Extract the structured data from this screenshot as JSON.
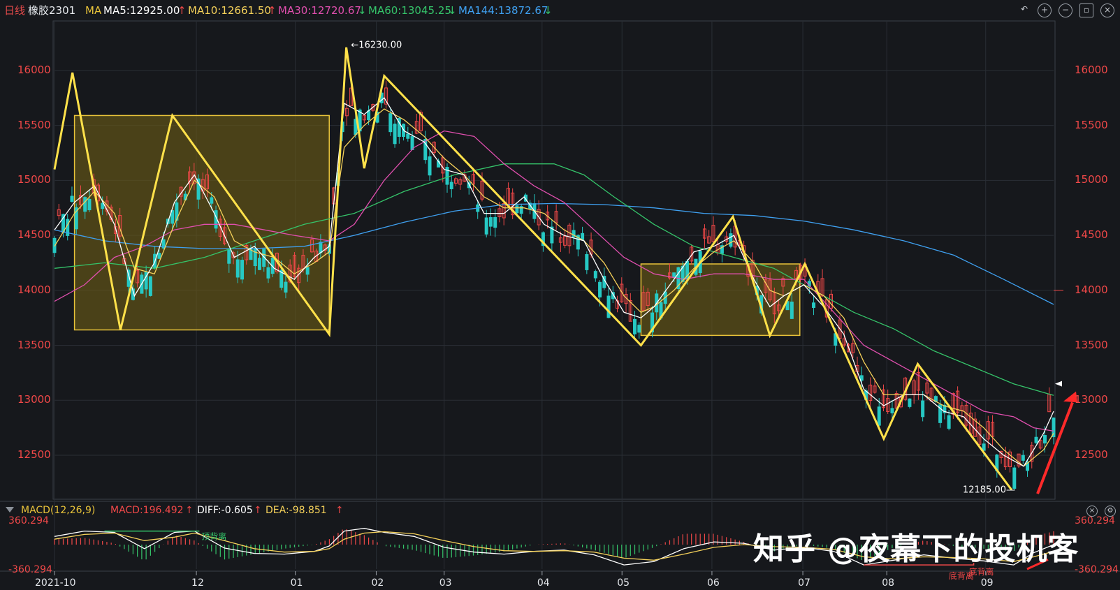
{
  "header": {
    "period": "日线",
    "symbol": "橡胶2301",
    "ma_prefix": "MA",
    "ma5": "MA5:12925.00",
    "ma10": "MA10:12661.50",
    "ma30": "MA30:12720.67",
    "ma60": "MA60:13045.25",
    "ma144": "MA144:13872.67",
    "arrow_up": "↑",
    "arrow_down": "↓",
    "icons": [
      "undo-icon",
      "zoom-in-icon",
      "zoom-out-icon",
      "layout-icon",
      "close-icon"
    ]
  },
  "macd_header": {
    "name": "MACD(12,26,9)",
    "macd": "MACD:196.492",
    "diff": "DIFF:-0.605",
    "dea": "DEA:-98.851",
    "arrow_up": "↑"
  },
  "colors": {
    "up": "#f04848",
    "down": "#26c9c4",
    "ma5": "#ffffff",
    "ma10": "#f5d15a",
    "ma30": "#e04fae",
    "ma60": "#35c46a",
    "ma144": "#3fa0f0",
    "zigzag": "#ffe14a",
    "box_fill": "#6b5a16",
    "box_stroke": "#e8c33a",
    "grid": "#2a2e35"
  },
  "watermark": "知乎 @夜幕下的投机客",
  "chart_data": {
    "type": "candlestick",
    "ylim": [
      12100,
      16450
    ],
    "y_ticks": [
      12500,
      13000,
      13500,
      14000,
      14500,
      15000,
      15500,
      16000
    ],
    "x_ticks": [
      "2021-10",
      "12",
      "01",
      "02",
      "03",
      "04",
      "05",
      "06",
      "07",
      "08",
      "09"
    ],
    "annotations": {
      "high": "16230.00",
      "low": "12185.00",
      "current_marker": 14000,
      "macd_max": "360.294",
      "macd_min": "-360.294",
      "divergence_1": "顶背离",
      "divergence_2": "底背离",
      "divergence_3": "底背离"
    },
    "boxes": [
      {
        "x0": 0.02,
        "x1": 0.275,
        "y0": 13640,
        "y1": 15590
      },
      {
        "x0": 0.587,
        "x1": 0.746,
        "y0": 13590,
        "y1": 14240
      }
    ],
    "zigzag": [
      [
        0.0,
        15100
      ],
      [
        0.018,
        15980
      ],
      [
        0.066,
        13640
      ],
      [
        0.118,
        15590
      ],
      [
        0.275,
        13600
      ],
      [
        0.292,
        16210
      ],
      [
        0.31,
        15110
      ],
      [
        0.33,
        15950
      ],
      [
        0.587,
        13500
      ],
      [
        0.679,
        14670
      ],
      [
        0.716,
        13590
      ],
      [
        0.751,
        14240
      ],
      [
        0.83,
        12650
      ],
      [
        0.864,
        13330
      ],
      [
        0.958,
        12185
      ]
    ],
    "ma5": [
      [
        0,
        14550
      ],
      [
        0.02,
        14800
      ],
      [
        0.04,
        14950
      ],
      [
        0.06,
        14600
      ],
      [
        0.08,
        13950
      ],
      [
        0.1,
        14250
      ],
      [
        0.12,
        14800
      ],
      [
        0.14,
        15050
      ],
      [
        0.16,
        14700
      ],
      [
        0.18,
        14300
      ],
      [
        0.2,
        14400
      ],
      [
        0.22,
        14200
      ],
      [
        0.24,
        14100
      ],
      [
        0.26,
        14300
      ],
      [
        0.275,
        14400
      ],
      [
        0.29,
        15700
      ],
      [
        0.31,
        15600
      ],
      [
        0.33,
        15750
      ],
      [
        0.35,
        15450
      ],
      [
        0.37,
        15350
      ],
      [
        0.39,
        15100
      ],
      [
        0.41,
        15050
      ],
      [
        0.43,
        14700
      ],
      [
        0.45,
        14700
      ],
      [
        0.47,
        14850
      ],
      [
        0.49,
        14600
      ],
      [
        0.51,
        14500
      ],
      [
        0.53,
        14450
      ],
      [
        0.55,
        14100
      ],
      [
        0.57,
        13800
      ],
      [
        0.587,
        13750
      ],
      [
        0.6,
        13850
      ],
      [
        0.62,
        14100
      ],
      [
        0.64,
        14350
      ],
      [
        0.66,
        14400
      ],
      [
        0.68,
        14500
      ],
      [
        0.7,
        14100
      ],
      [
        0.716,
        13850
      ],
      [
        0.73,
        13950
      ],
      [
        0.75,
        14050
      ],
      [
        0.77,
        13850
      ],
      [
        0.79,
        13600
      ],
      [
        0.81,
        13100
      ],
      [
        0.83,
        12950
      ],
      [
        0.85,
        13050
      ],
      [
        0.87,
        13050
      ],
      [
        0.89,
        12900
      ],
      [
        0.91,
        12850
      ],
      [
        0.93,
        12650
      ],
      [
        0.95,
        12500
      ],
      [
        0.97,
        12400
      ],
      [
        0.99,
        12700
      ],
      [
        1.0,
        12900
      ]
    ],
    "ma10": [
      [
        0,
        14400
      ],
      [
        0.02,
        14700
      ],
      [
        0.04,
        14900
      ],
      [
        0.06,
        14700
      ],
      [
        0.08,
        14200
      ],
      [
        0.1,
        14150
      ],
      [
        0.12,
        14600
      ],
      [
        0.14,
        15000
      ],
      [
        0.16,
        14850
      ],
      [
        0.18,
        14450
      ],
      [
        0.2,
        14350
      ],
      [
        0.22,
        14300
      ],
      [
        0.24,
        14150
      ],
      [
        0.26,
        14250
      ],
      [
        0.275,
        14350
      ],
      [
        0.29,
        15300
      ],
      [
        0.31,
        15500
      ],
      [
        0.33,
        15650
      ],
      [
        0.35,
        15550
      ],
      [
        0.37,
        15400
      ],
      [
        0.39,
        15200
      ],
      [
        0.41,
        15050
      ],
      [
        0.43,
        14850
      ],
      [
        0.45,
        14750
      ],
      [
        0.47,
        14750
      ],
      [
        0.49,
        14700
      ],
      [
        0.51,
        14550
      ],
      [
        0.53,
        14450
      ],
      [
        0.55,
        14250
      ],
      [
        0.57,
        13950
      ],
      [
        0.587,
        13800
      ],
      [
        0.6,
        13850
      ],
      [
        0.62,
        14000
      ],
      [
        0.64,
        14200
      ],
      [
        0.66,
        14350
      ],
      [
        0.68,
        14450
      ],
      [
        0.7,
        14250
      ],
      [
        0.716,
        14000
      ],
      [
        0.73,
        13950
      ],
      [
        0.75,
        14050
      ],
      [
        0.77,
        13950
      ],
      [
        0.79,
        13750
      ],
      [
        0.81,
        13350
      ],
      [
        0.83,
        13050
      ],
      [
        0.85,
        13050
      ],
      [
        0.87,
        13050
      ],
      [
        0.89,
        12950
      ],
      [
        0.91,
        12900
      ],
      [
        0.93,
        12750
      ],
      [
        0.95,
        12550
      ],
      [
        0.97,
        12400
      ],
      [
        0.99,
        12550
      ],
      [
        1.0,
        12700
      ]
    ],
    "ma30": [
      [
        0,
        13900
      ],
      [
        0.03,
        14050
      ],
      [
        0.06,
        14300
      ],
      [
        0.09,
        14400
      ],
      [
        0.12,
        14550
      ],
      [
        0.15,
        14600
      ],
      [
        0.18,
        14600
      ],
      [
        0.21,
        14550
      ],
      [
        0.24,
        14500
      ],
      [
        0.275,
        14450
      ],
      [
        0.3,
        14600
      ],
      [
        0.33,
        15000
      ],
      [
        0.36,
        15300
      ],
      [
        0.39,
        15450
      ],
      [
        0.42,
        15400
      ],
      [
        0.45,
        15150
      ],
      [
        0.48,
        14950
      ],
      [
        0.51,
        14800
      ],
      [
        0.54,
        14550
      ],
      [
        0.57,
        14300
      ],
      [
        0.6,
        14150
      ],
      [
        0.63,
        14100
      ],
      [
        0.66,
        14150
      ],
      [
        0.69,
        14150
      ],
      [
        0.72,
        14100
      ],
      [
        0.75,
        14100
      ],
      [
        0.78,
        13800
      ],
      [
        0.81,
        13500
      ],
      [
        0.84,
        13350
      ],
      [
        0.87,
        13200
      ],
      [
        0.9,
        13050
      ],
      [
        0.93,
        12900
      ],
      [
        0.96,
        12850
      ],
      [
        0.98,
        12750
      ],
      [
        1.0,
        12720
      ]
    ],
    "ma60": [
      [
        0,
        14200
      ],
      [
        0.05,
        14250
      ],
      [
        0.1,
        14200
      ],
      [
        0.15,
        14300
      ],
      [
        0.2,
        14450
      ],
      [
        0.25,
        14600
      ],
      [
        0.3,
        14700
      ],
      [
        0.35,
        14900
      ],
      [
        0.4,
        15050
      ],
      [
        0.45,
        15150
      ],
      [
        0.5,
        15150
      ],
      [
        0.53,
        15050
      ],
      [
        0.56,
        14850
      ],
      [
        0.6,
        14600
      ],
      [
        0.64,
        14400
      ],
      [
        0.68,
        14300
      ],
      [
        0.72,
        14200
      ],
      [
        0.76,
        14000
      ],
      [
        0.8,
        13800
      ],
      [
        0.84,
        13650
      ],
      [
        0.88,
        13450
      ],
      [
        0.92,
        13300
      ],
      [
        0.96,
        13150
      ],
      [
        1.0,
        13045
      ]
    ],
    "ma144": [
      [
        0,
        14550
      ],
      [
        0.05,
        14450
      ],
      [
        0.1,
        14400
      ],
      [
        0.15,
        14380
      ],
      [
        0.2,
        14380
      ],
      [
        0.25,
        14400
      ],
      [
        0.3,
        14500
      ],
      [
        0.35,
        14620
      ],
      [
        0.4,
        14720
      ],
      [
        0.45,
        14780
      ],
      [
        0.5,
        14790
      ],
      [
        0.55,
        14780
      ],
      [
        0.6,
        14750
      ],
      [
        0.65,
        14700
      ],
      [
        0.7,
        14680
      ],
      [
        0.75,
        14630
      ],
      [
        0.8,
        14550
      ],
      [
        0.85,
        14450
      ],
      [
        0.9,
        14320
      ],
      [
        0.95,
        14100
      ],
      [
        1.0,
        13872
      ]
    ],
    "diff": [
      [
        0,
        120
      ],
      [
        0.03,
        200
      ],
      [
        0.06,
        180
      ],
      [
        0.09,
        -60
      ],
      [
        0.12,
        180
      ],
      [
        0.14,
        200
      ],
      [
        0.17,
        -50
      ],
      [
        0.2,
        -130
      ],
      [
        0.23,
        -140
      ],
      [
        0.26,
        -100
      ],
      [
        0.275,
        -20
      ],
      [
        0.29,
        200
      ],
      [
        0.31,
        240
      ],
      [
        0.33,
        180
      ],
      [
        0.36,
        120
      ],
      [
        0.39,
        -40
      ],
      [
        0.42,
        -110
      ],
      [
        0.45,
        -140
      ],
      [
        0.48,
        -100
      ],
      [
        0.51,
        -80
      ],
      [
        0.54,
        -150
      ],
      [
        0.57,
        -300
      ],
      [
        0.6,
        -250
      ],
      [
        0.63,
        -60
      ],
      [
        0.66,
        40
      ],
      [
        0.69,
        20
      ],
      [
        0.72,
        -80
      ],
      [
        0.75,
        -40
      ],
      [
        0.78,
        -100
      ],
      [
        0.81,
        -300
      ],
      [
        0.84,
        -230
      ],
      [
        0.87,
        -150
      ],
      [
        0.9,
        -200
      ],
      [
        0.93,
        -240
      ],
      [
        0.96,
        -300
      ],
      [
        0.98,
        -120
      ],
      [
        1.0,
        -1
      ]
    ],
    "dea": [
      [
        0,
        80
      ],
      [
        0.03,
        150
      ],
      [
        0.06,
        170
      ],
      [
        0.09,
        60
      ],
      [
        0.12,
        110
      ],
      [
        0.14,
        170
      ],
      [
        0.17,
        60
      ],
      [
        0.2,
        -60
      ],
      [
        0.23,
        -110
      ],
      [
        0.26,
        -100
      ],
      [
        0.275,
        -60
      ],
      [
        0.29,
        80
      ],
      [
        0.31,
        170
      ],
      [
        0.33,
        190
      ],
      [
        0.36,
        160
      ],
      [
        0.39,
        60
      ],
      [
        0.42,
        -30
      ],
      [
        0.45,
        -90
      ],
      [
        0.48,
        -100
      ],
      [
        0.51,
        -90
      ],
      [
        0.54,
        -110
      ],
      [
        0.57,
        -200
      ],
      [
        0.6,
        -230
      ],
      [
        0.63,
        -140
      ],
      [
        0.66,
        -40
      ],
      [
        0.69,
        0
      ],
      [
        0.72,
        -30
      ],
      [
        0.75,
        -40
      ],
      [
        0.78,
        -70
      ],
      [
        0.81,
        -180
      ],
      [
        0.84,
        -210
      ],
      [
        0.87,
        -180
      ],
      [
        0.9,
        -190
      ],
      [
        0.93,
        -210
      ],
      [
        0.96,
        -250
      ],
      [
        0.98,
        -180
      ],
      [
        1.0,
        -99
      ]
    ]
  }
}
